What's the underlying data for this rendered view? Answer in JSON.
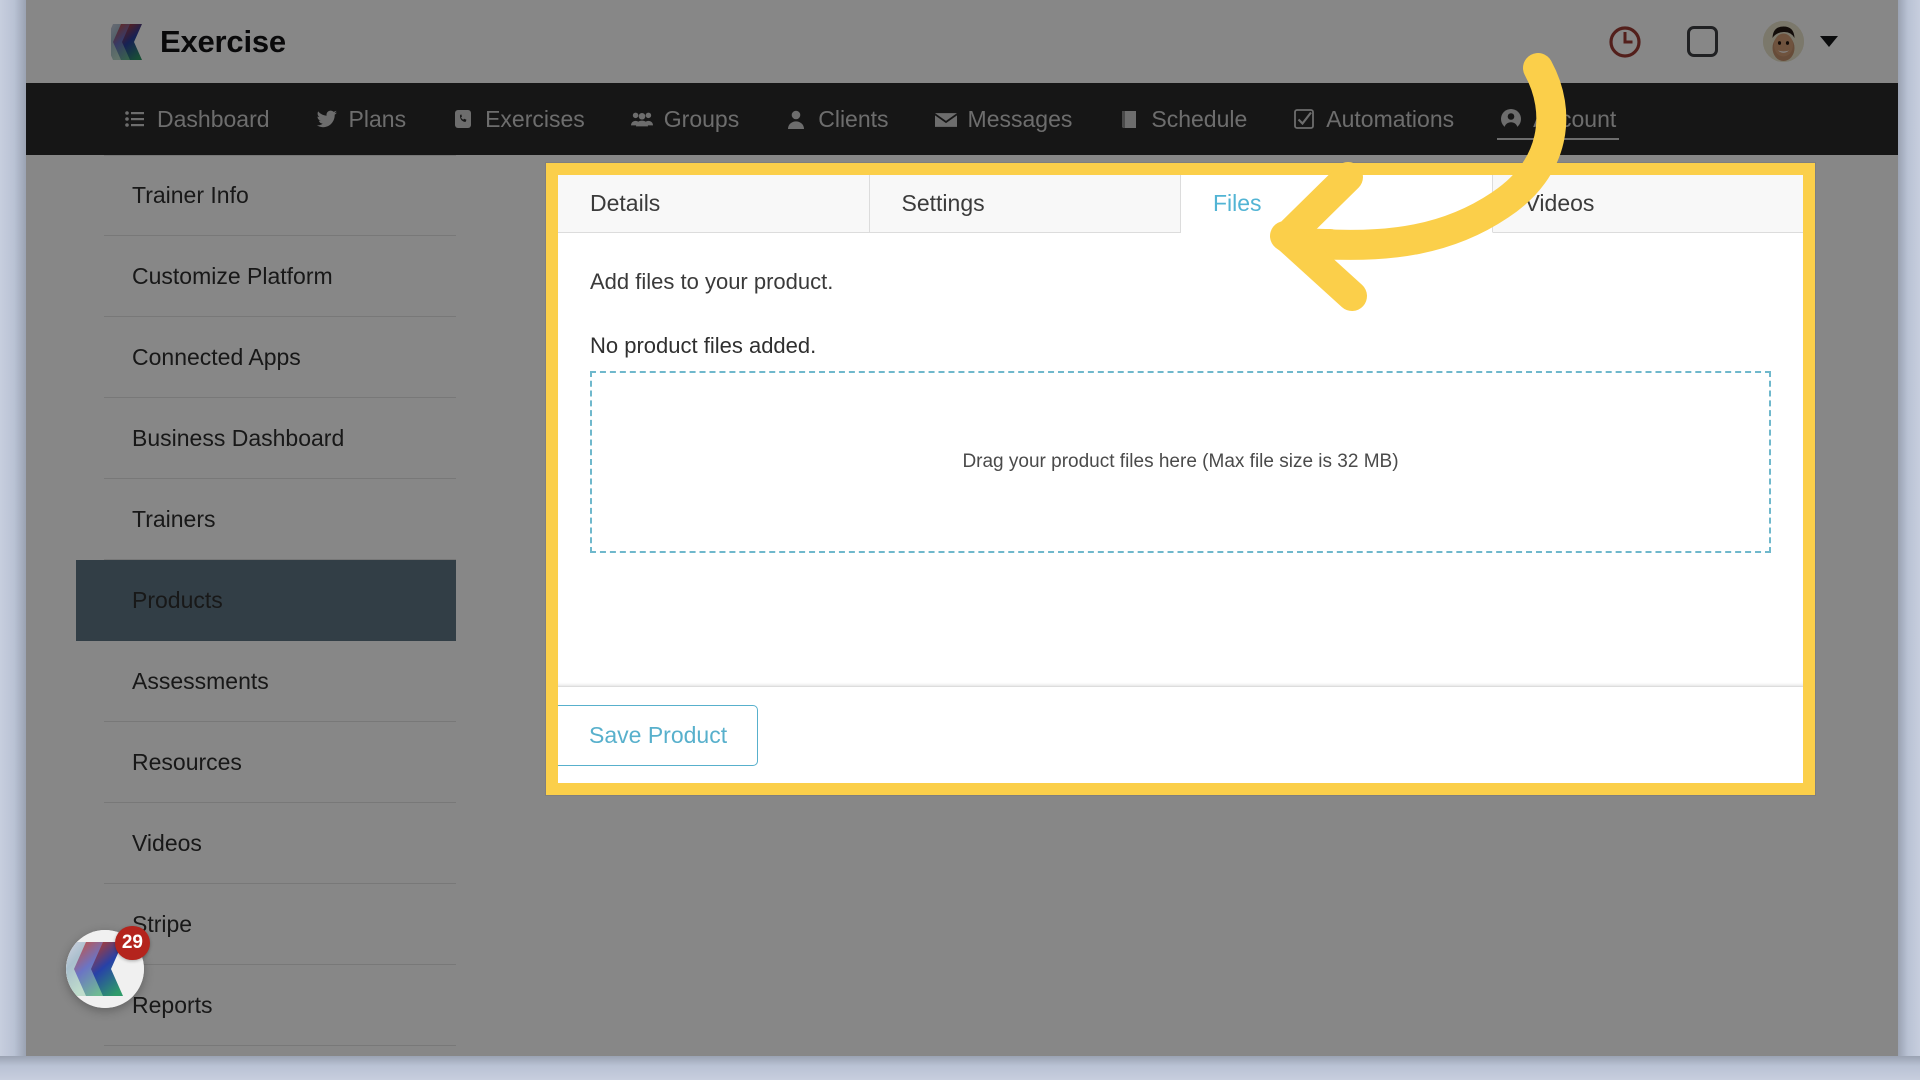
{
  "brand": {
    "name": "Exercise",
    "logo_icon": "chevron-stack-logo"
  },
  "header": {
    "clock_icon": "clock-icon",
    "square_icon": "square-outline-icon",
    "avatar_icon": "user-avatar",
    "chevron_icon": "chevron-down-icon"
  },
  "nav": {
    "items": [
      {
        "label": "Dashboard",
        "icon": "list-icon",
        "active": false
      },
      {
        "label": "Plans",
        "icon": "bird-icon",
        "active": false
      },
      {
        "label": "Exercises",
        "icon": "phone-icon",
        "active": false
      },
      {
        "label": "Groups",
        "icon": "people-group-icon",
        "active": false
      },
      {
        "label": "Clients",
        "icon": "person-icon",
        "active": false
      },
      {
        "label": "Messages",
        "icon": "envelope-icon",
        "active": false
      },
      {
        "label": "Schedule",
        "icon": "book-icon",
        "active": false
      },
      {
        "label": "Automations",
        "icon": "check-square-icon",
        "active": false
      },
      {
        "label": "Account",
        "icon": "user-circle-icon",
        "active": true
      }
    ]
  },
  "sidebar": {
    "items": [
      {
        "label": "Trainer Info",
        "active": false
      },
      {
        "label": "Customize Platform",
        "active": false
      },
      {
        "label": "Connected Apps",
        "active": false
      },
      {
        "label": "Business Dashboard",
        "active": false
      },
      {
        "label": "Trainers",
        "active": false
      },
      {
        "label": "Products",
        "active": true
      },
      {
        "label": "Assessments",
        "active": false
      },
      {
        "label": "Resources",
        "active": false
      },
      {
        "label": "Videos",
        "active": false
      },
      {
        "label": "Stripe",
        "active": false
      },
      {
        "label": "Reports",
        "active": false
      }
    ]
  },
  "chat_widget": {
    "badge_count": "29",
    "icon": "chat-launcher-icon"
  },
  "modal": {
    "tabs": [
      {
        "label": "Details",
        "active": false
      },
      {
        "label": "Settings",
        "active": false
      },
      {
        "label": "Files",
        "active": true
      },
      {
        "label": "Videos",
        "active": false
      }
    ],
    "files_panel": {
      "lead": "Add files to your product.",
      "empty_state": "No product files added.",
      "dropzone_text": "Drag your product files here (Max file size is 32 MB)"
    },
    "save_button": "Save Product"
  },
  "annotation": {
    "arrow_color": "#fbcf4a",
    "highlight_color": "#fbcf4a",
    "points_to": "Files"
  },
  "colors": {
    "accent_blue": "#52b4d4",
    "nav_dark": "#2a2a2a",
    "sidebar_active": "#5f7684",
    "badge_red": "#b4241d",
    "highlight_yellow": "#fbcf4a"
  }
}
